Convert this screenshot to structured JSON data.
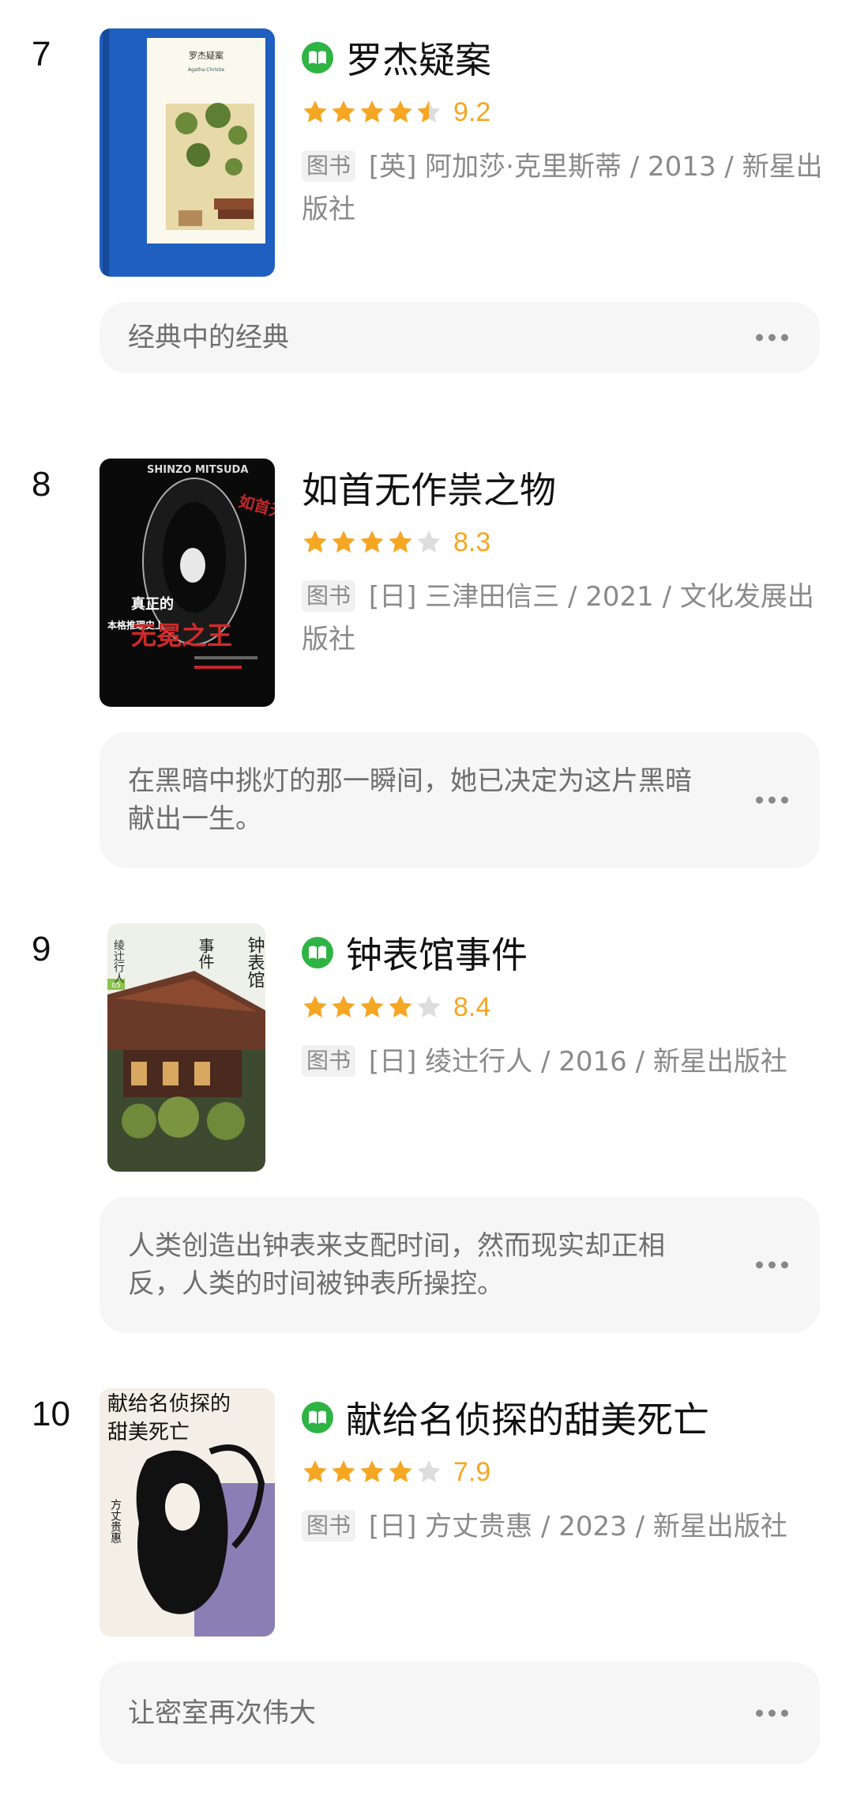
{
  "books": [
    {
      "rank": "7",
      "title": "罗杰疑案",
      "has_read_icon": true,
      "rating_stars": 4.5,
      "score": "9.2",
      "type_tag": "图书",
      "meta": "[英] 阿加莎·克里斯蒂 / 2013 / 新星出版社",
      "comment": "经典中的经典"
    },
    {
      "rank": "8",
      "title": "如首无作祟之物",
      "has_read_icon": false,
      "rating_stars": 4,
      "score": "8.3",
      "type_tag": "图书",
      "meta": "[日] 三津田信三 / 2021 / 文化发展出版社",
      "comment": "在黑暗中挑灯的那一瞬间，她已决定为这片黑暗献出一生。"
    },
    {
      "rank": "9",
      "title": "钟表馆事件",
      "has_read_icon": true,
      "rating_stars": 4,
      "score": "8.4",
      "type_tag": "图书",
      "meta": "[日] 绫辻行人 / 2016 / 新星出版社",
      "comment": "人类创造出钟表来支配时间，然而现实却正相反，人类的时间被钟表所操控。"
    },
    {
      "rank": "10",
      "title": "献给名侦探的甜美死亡",
      "has_read_icon": true,
      "rating_stars": 4,
      "score": "7.9",
      "type_tag": "图书",
      "meta": "[日] 方丈贵惠 / 2023 / 新星出版社",
      "comment": "让密室再次伟大"
    }
  ],
  "covers": {
    "book7": {
      "header": "罗杰疑案",
      "sub": "Agatha Christie"
    },
    "book8": {
      "top": "SHINZO MITSUDA",
      "title": "如首无作祟之物",
      "side": "本格推理史上",
      "big": "真正的",
      "big2": "无冕之王"
    },
    "book9": {
      "vertical": "钟表馆",
      "vertical2": "事件",
      "author": "绫辻行人",
      "number": "05"
    },
    "book10": {
      "title": "献给名侦探的",
      "title2": "甜美死亡",
      "author": "方丈贵惠"
    }
  },
  "colors": {
    "accent_star": "#f5a623",
    "star_empty": "#dddddd",
    "read_icon": "#2fb344"
  }
}
